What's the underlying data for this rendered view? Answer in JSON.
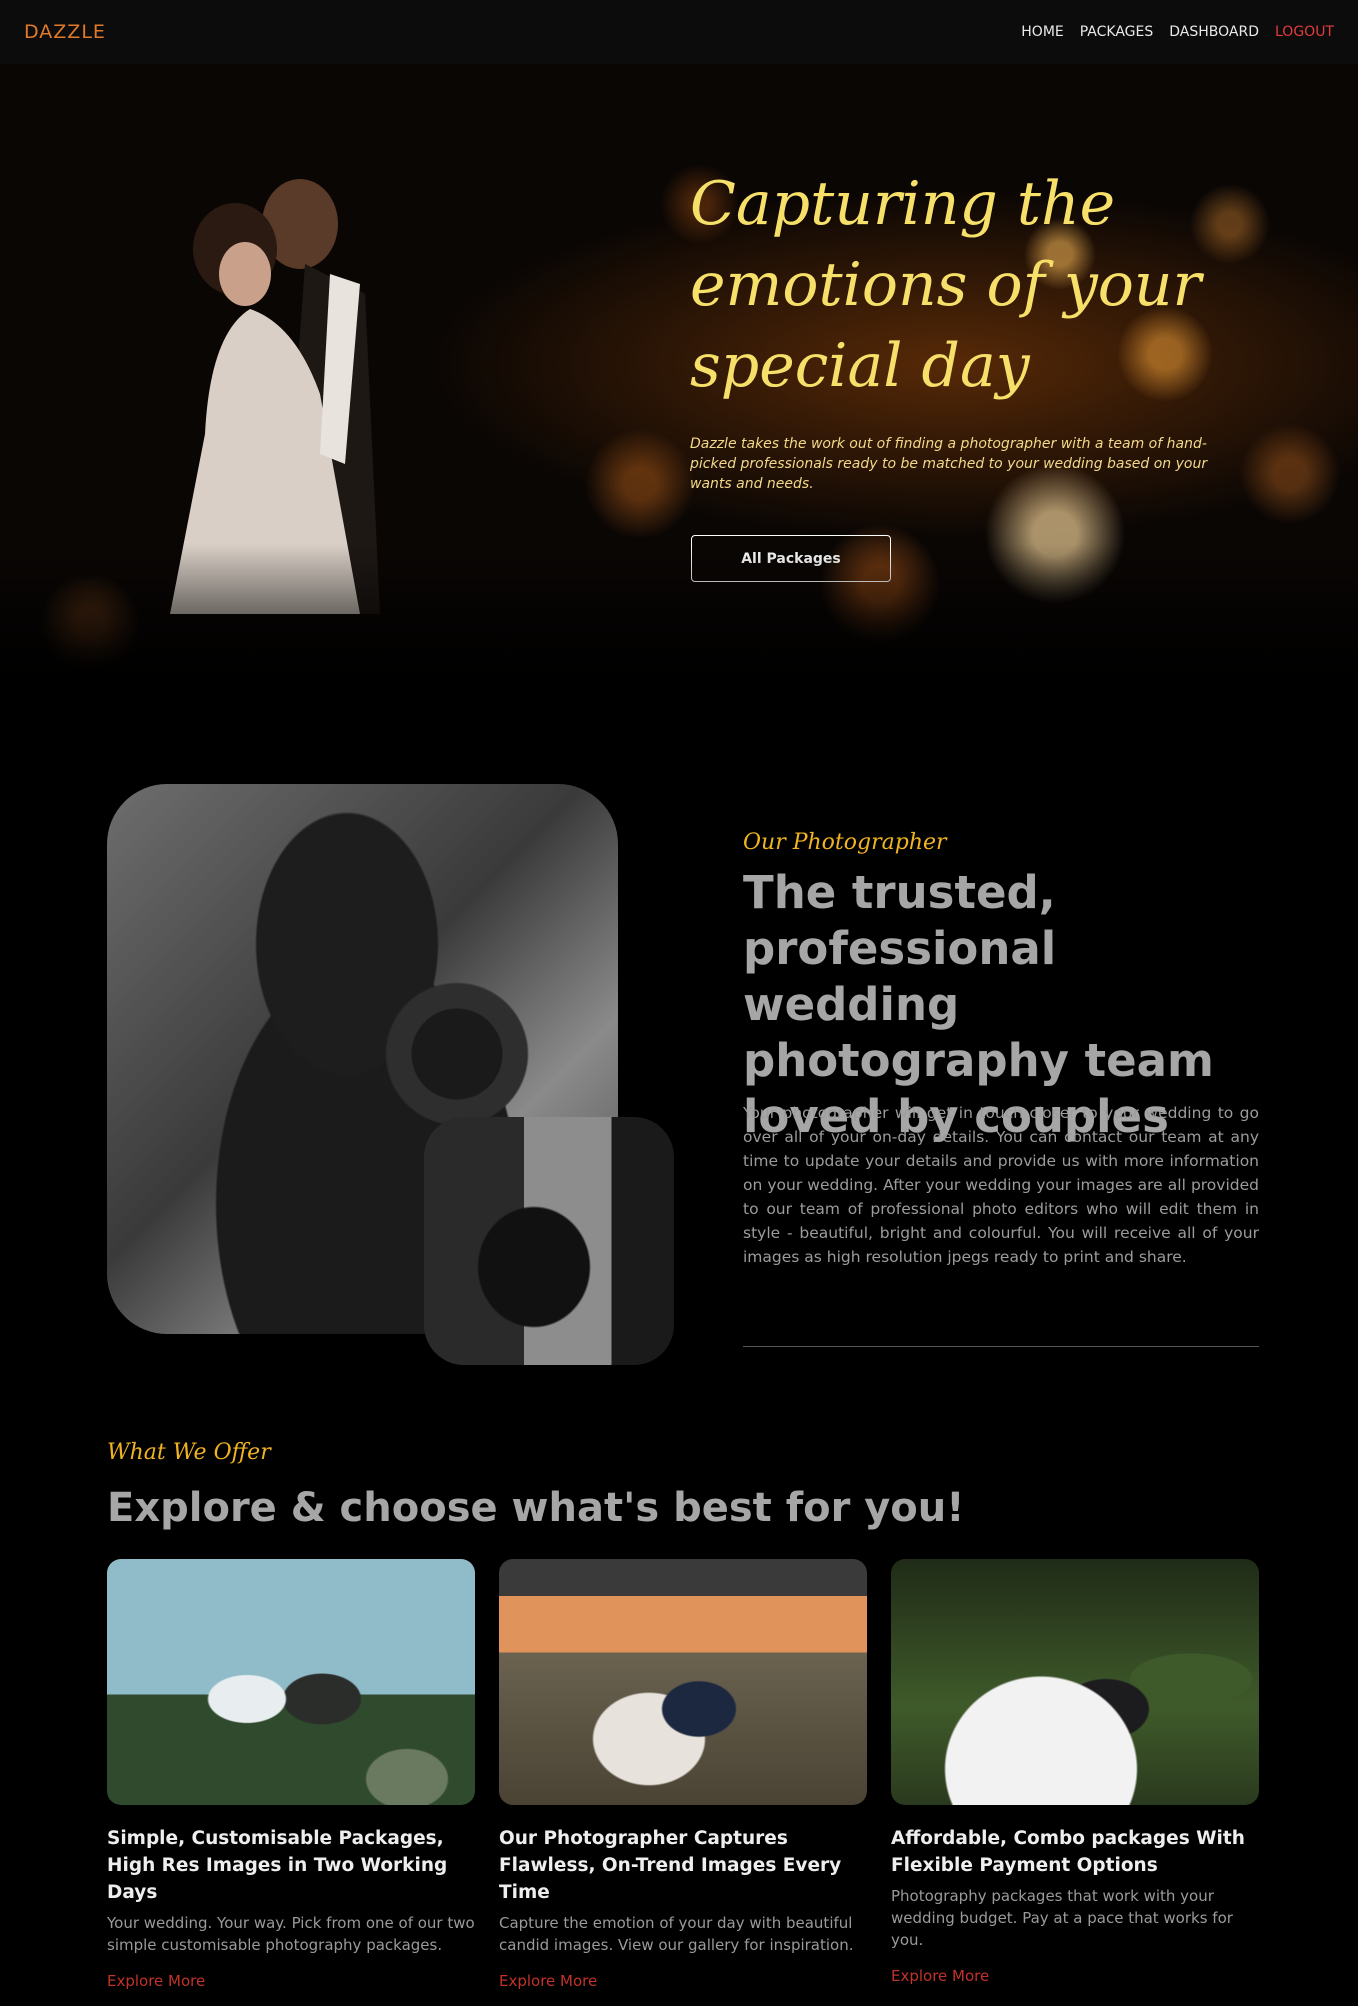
{
  "nav": {
    "brand": "DAZZLE",
    "links": [
      "HOME",
      "PACKAGES",
      "DASHBOARD"
    ],
    "logout": "LOGOUT"
  },
  "hero": {
    "title": "Capturing the emotions of your special day",
    "description": "Dazzle takes the work out of finding a photographer with a team of hand-picked professionals ready to be matched to your wedding based on your wants and needs.",
    "button": "All Packages"
  },
  "about": {
    "eyebrow": "Our Photographer",
    "title": "The trusted, professional wedding photography team loved by couples",
    "text": "Your photographer will get in touch closer to your wedding to go over all of your on-day details. You can contact our team at any time to update your details and provide us with more information on your wedding. After your wedding your images are all provided to our team of professional photo editors who will edit them in style - beautiful, bright and colourful. You will receive all of your images as high resolution jpegs ready to print and share."
  },
  "offers": {
    "eyebrow": "What We Offer",
    "title": "Explore & choose what's best for you!",
    "cards": [
      {
        "title": "Simple, Customisable Packages, High Res Images in Two Working Days",
        "text": "Your wedding. Your way. Pick from one of our two simple customisable photography packages.",
        "link": "Explore More"
      },
      {
        "title": "Our Photographer Captures Flawless, On-Trend Images Every Time",
        "text": "Capture the emotion of your day with beautiful candid images. View our gallery for inspiration.",
        "link": "Explore More"
      },
      {
        "title": "Affordable, Combo packages With Flexible Payment Options",
        "text": "Photography packages that work with your wedding budget. Pay at a pace that works for you.",
        "link": "Explore More"
      }
    ]
  },
  "colors": {
    "brand": "#e07a2a",
    "logout": "#e33b3b",
    "script_accent": "#f0b422",
    "hero_title": "#f7e06a",
    "link_red": "#c0322a"
  }
}
